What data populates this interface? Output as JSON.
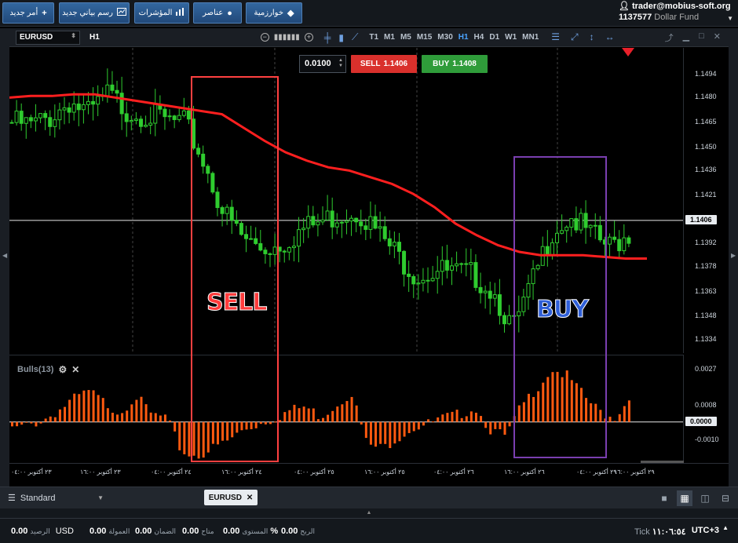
{
  "toolbar": {
    "new_order": "أمر جديد",
    "new_chart": "رسم بياني جديد",
    "indicators": "المؤشرات",
    "elements": "عناصر",
    "algorithms": "خوارزمية"
  },
  "account": {
    "email": "trader@mobius-soft.org",
    "number": "1137577",
    "fund": "Dollar Fund"
  },
  "chart": {
    "symbol": "EURUSD",
    "timeframe": "H1",
    "timeframes": [
      "T1",
      "M1",
      "M5",
      "M15",
      "M30",
      "H1",
      "H4",
      "D1",
      "W1",
      "MN1"
    ],
    "active_timeframe": "H1",
    "lot": "0.0100",
    "sell_label": "SELL",
    "sell_price": "1.1406",
    "buy_label": "BUY",
    "buy_price": "1.1408",
    "current_price": "1.1406",
    "annotation_sell": "SELL",
    "annotation_buy": "BUY",
    "annotation_sell_color": "#ff3b3b",
    "annotation_buy_color": "#2f5fd8",
    "sell_box_color": "#ff4040",
    "buy_box_color": "#7a3fb0",
    "ma_color": "#ff1f1f",
    "candle_color": "#2fcc2f"
  },
  "indicator": {
    "title": "Bulls(13)",
    "bar_color": "#ff5a10",
    "current_value": "0.0000"
  },
  "chart_data": {
    "type": "candlestick",
    "symbol": "EURUSD",
    "timeframe": "H1",
    "yticks": [
      "1.1494",
      "1.1480",
      "1.1465",
      "1.1450",
      "1.1436",
      "1.1421",
      "1.1406",
      "1.1392",
      "1.1378",
      "1.1363",
      "1.1348",
      "1.1334"
    ],
    "ylim": [
      1.1326,
      1.151
    ],
    "current_price": 1.1406,
    "moving_average": [
      1.148,
      1.1481,
      1.1481,
      1.1482,
      1.1482,
      1.148,
      1.1478,
      1.1476,
      1.1474,
      1.1472,
      1.147,
      1.1462,
      1.1454,
      1.1447,
      1.1442,
      1.1438,
      1.1436,
      1.1432,
      1.1428,
      1.1422,
      1.1414,
      1.1404,
      1.1397,
      1.1391,
      1.1387,
      1.1385,
      1.1385,
      1.1385,
      1.1384,
      1.1383,
      1.1383
    ],
    "close_path": [
      1.1465,
      1.1463,
      1.1468,
      1.1478,
      1.147,
      1.1482,
      1.1472,
      1.147,
      1.1466,
      1.1464,
      1.144,
      1.141,
      1.1395,
      1.1389,
      1.1392,
      1.14,
      1.1405,
      1.141,
      1.1412,
      1.1398,
      1.1385,
      1.1373,
      1.1376,
      1.1374,
      1.1373,
      1.1363,
      1.134,
      1.1368,
      1.14,
      1.1408,
      1.1397,
      1.139,
      1.1398
    ],
    "indicator": {
      "name": "Bulls(13)",
      "yticks": [
        "0.0027",
        "0.0008",
        "0.0000",
        "-0.0010"
      ],
      "values": [
        -0.0004,
        -0.0002,
        0.0001,
        0.0006,
        0.0012,
        0.0016,
        0.001,
        0.0005,
        0.0014,
        0.0004,
        0.0002,
        -0.0016,
        -0.0018,
        -0.0014,
        -0.001,
        -0.0004,
        -0.0001,
        0.0002,
        0.0006,
        0.0008,
        0.0003,
        0.0009,
        0.0016,
        -0.0012,
        -0.0014,
        -0.0008,
        -0.0003,
        -0.0001,
        0.0002,
        0.0004,
        0.0008,
        -0.0004,
        -0.0008,
        0.0008,
        0.0018,
        0.0028,
        0.0024,
        0.0014,
        0.0006,
        0.0002,
        0.0012
      ]
    },
    "xticks": [
      "٢٣ أكتوبر ٠٤:٠٠",
      "٢٣ أكتوبر ١٦:٠٠",
      "٢٤ أكتوبر ٠٤:٠٠",
      "٢٤ أكتوبر ١٦:٠٠",
      "٢٥ أكتوبر ٠٤:٠٠",
      "٢٥ أكتوبر ١٦:٠٠",
      "٢٦ أكتوبر ٠٤:٠٠",
      "٢٦ أكتوبر ١٦:٠٠",
      "٢٩ أكتوبر ٠٤:٠٠",
      "٢٩ أكتوبر ١٦:٠٠"
    ]
  },
  "tabs": {
    "layout": "Standard",
    "chart_tab": "EURUSD"
  },
  "status": {
    "balance_label": "الرصيد",
    "balance_value": "0.00",
    "currency": "USD",
    "commission_label": "العمولة",
    "commission_value": "0.00",
    "margin_label": "الضمان",
    "margin_value": "0.00",
    "free_label": "متاح",
    "free_value": "0.00",
    "level_label": "المستوى",
    "level_value": "0.00",
    "level_unit": "%",
    "profit_label": "الربح",
    "profit_value": "0.00",
    "tick_label": "Tick",
    "tick_time": "١١:٠٦:٥٤",
    "timezone": "UTC+3"
  }
}
